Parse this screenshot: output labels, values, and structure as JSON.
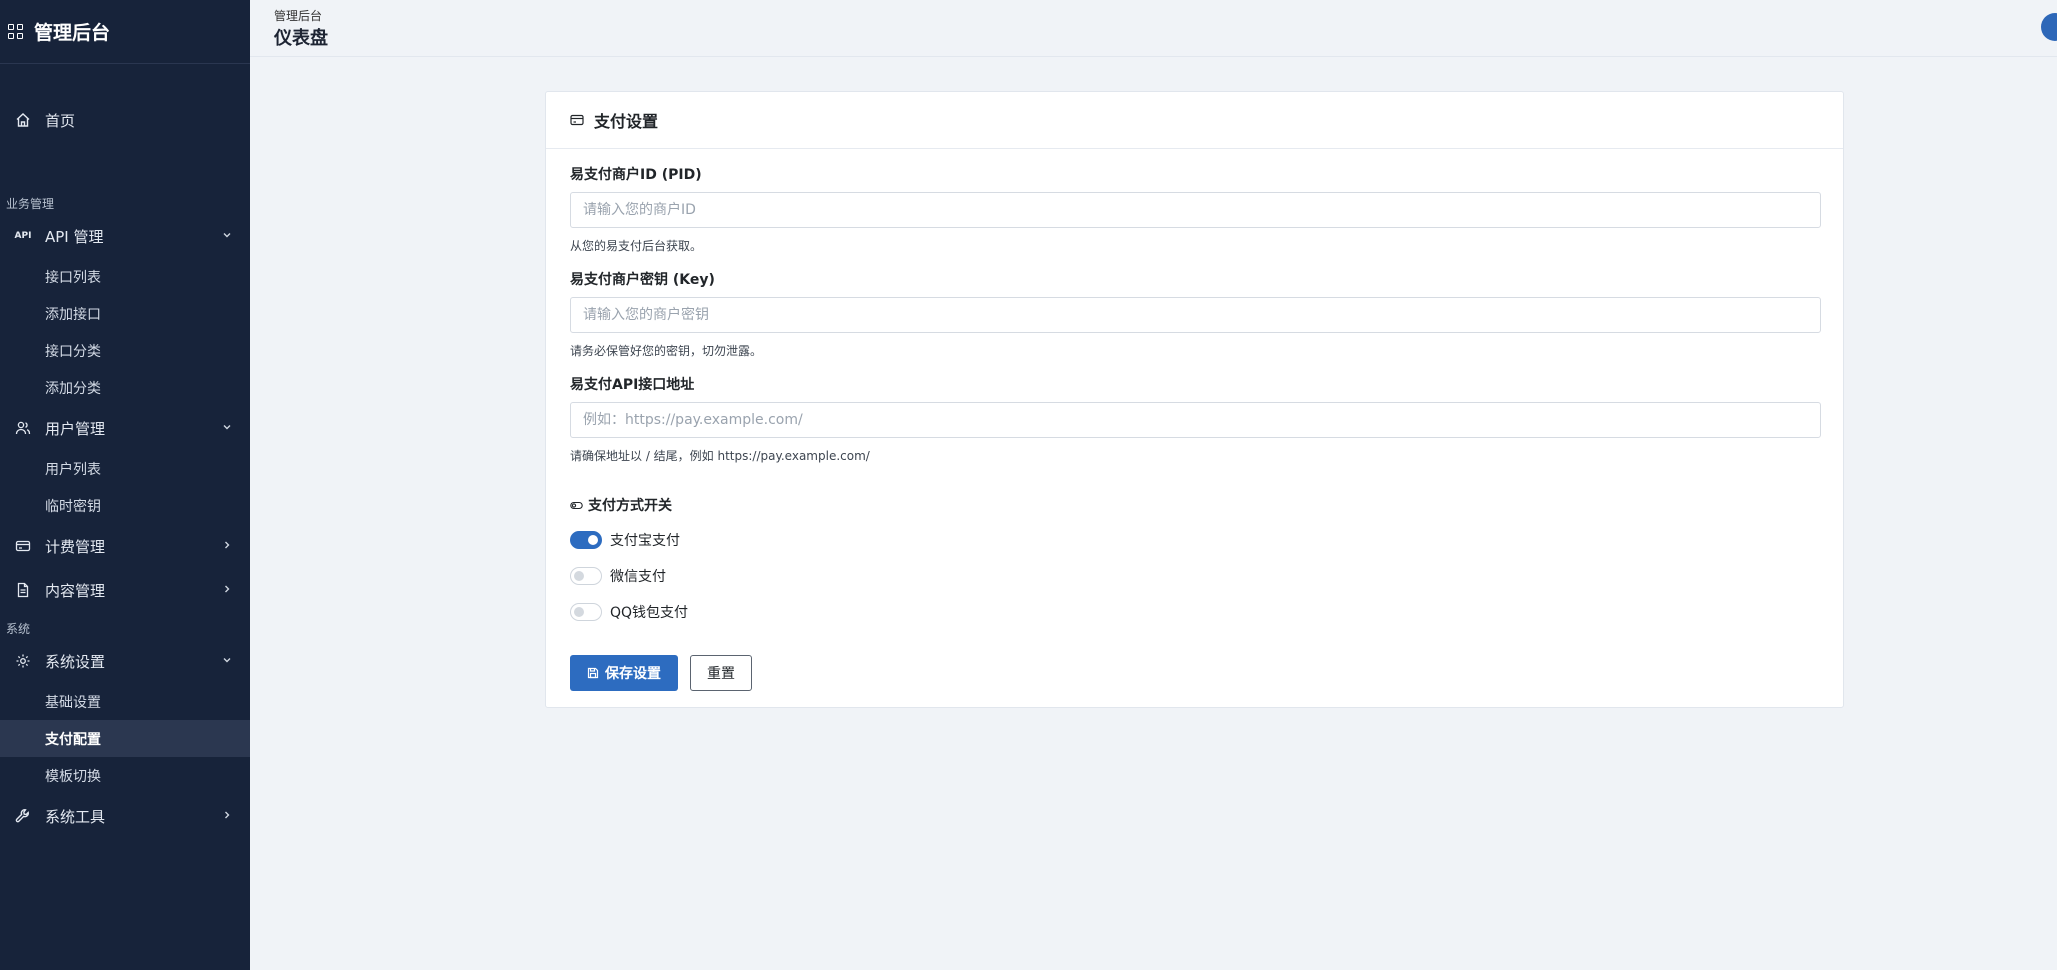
{
  "app": {
    "brand_title": "管理后台"
  },
  "sidebar": {
    "home": {
      "label": "首页",
      "icon": "home-icon"
    },
    "section_business": "业务管理",
    "api": {
      "label": "API 管理",
      "icon": "api-icon",
      "items": [
        "接口列表",
        "添加接口",
        "接口分类",
        "添加分类"
      ]
    },
    "users": {
      "label": "用户管理",
      "icon": "users-icon",
      "items": [
        "用户列表",
        "临时密钥"
      ]
    },
    "billing": {
      "label": "计费管理",
      "icon": "card-icon"
    },
    "content": {
      "label": "内容管理",
      "icon": "document-icon"
    },
    "section_system": "系统",
    "system_settings": {
      "label": "系统设置",
      "icon": "gear-icon",
      "items": [
        "基础设置",
        "支付配置",
        "模板切换"
      ],
      "active_index": 1
    },
    "tools": {
      "label": "系统工具",
      "icon": "wrench-icon"
    }
  },
  "header": {
    "breadcrumb": "管理后台",
    "title": "仪表盘"
  },
  "payment": {
    "card_title": "支付设置",
    "pid": {
      "label": "易支付商户ID (PID)",
      "value": "",
      "placeholder": "请输入您的商户ID",
      "help": "从您的易支付后台获取。"
    },
    "key": {
      "label": "易支付商户密钥 (Key)",
      "value": "",
      "placeholder": "请输入您的商户密钥",
      "help": "请务必保管好您的密钥，切勿泄露。"
    },
    "api_url": {
      "label": "易支付API接口地址",
      "value": "",
      "placeholder": "例如：https://pay.example.com/",
      "help": "请确保地址以 / 结尾，例如 https://pay.example.com/"
    },
    "methods_title": "支付方式开关",
    "methods": [
      {
        "label": "支付宝支付",
        "enabled": true
      },
      {
        "label": "微信支付",
        "enabled": false
      },
      {
        "label": "QQ钱包支付",
        "enabled": false
      }
    ],
    "save_label": "保存设置",
    "reset_label": "重置"
  },
  "colors": {
    "sidebar_bg": "#17233a",
    "primary": "#2d6cc0",
    "page_bg": "#f0f3f7"
  }
}
